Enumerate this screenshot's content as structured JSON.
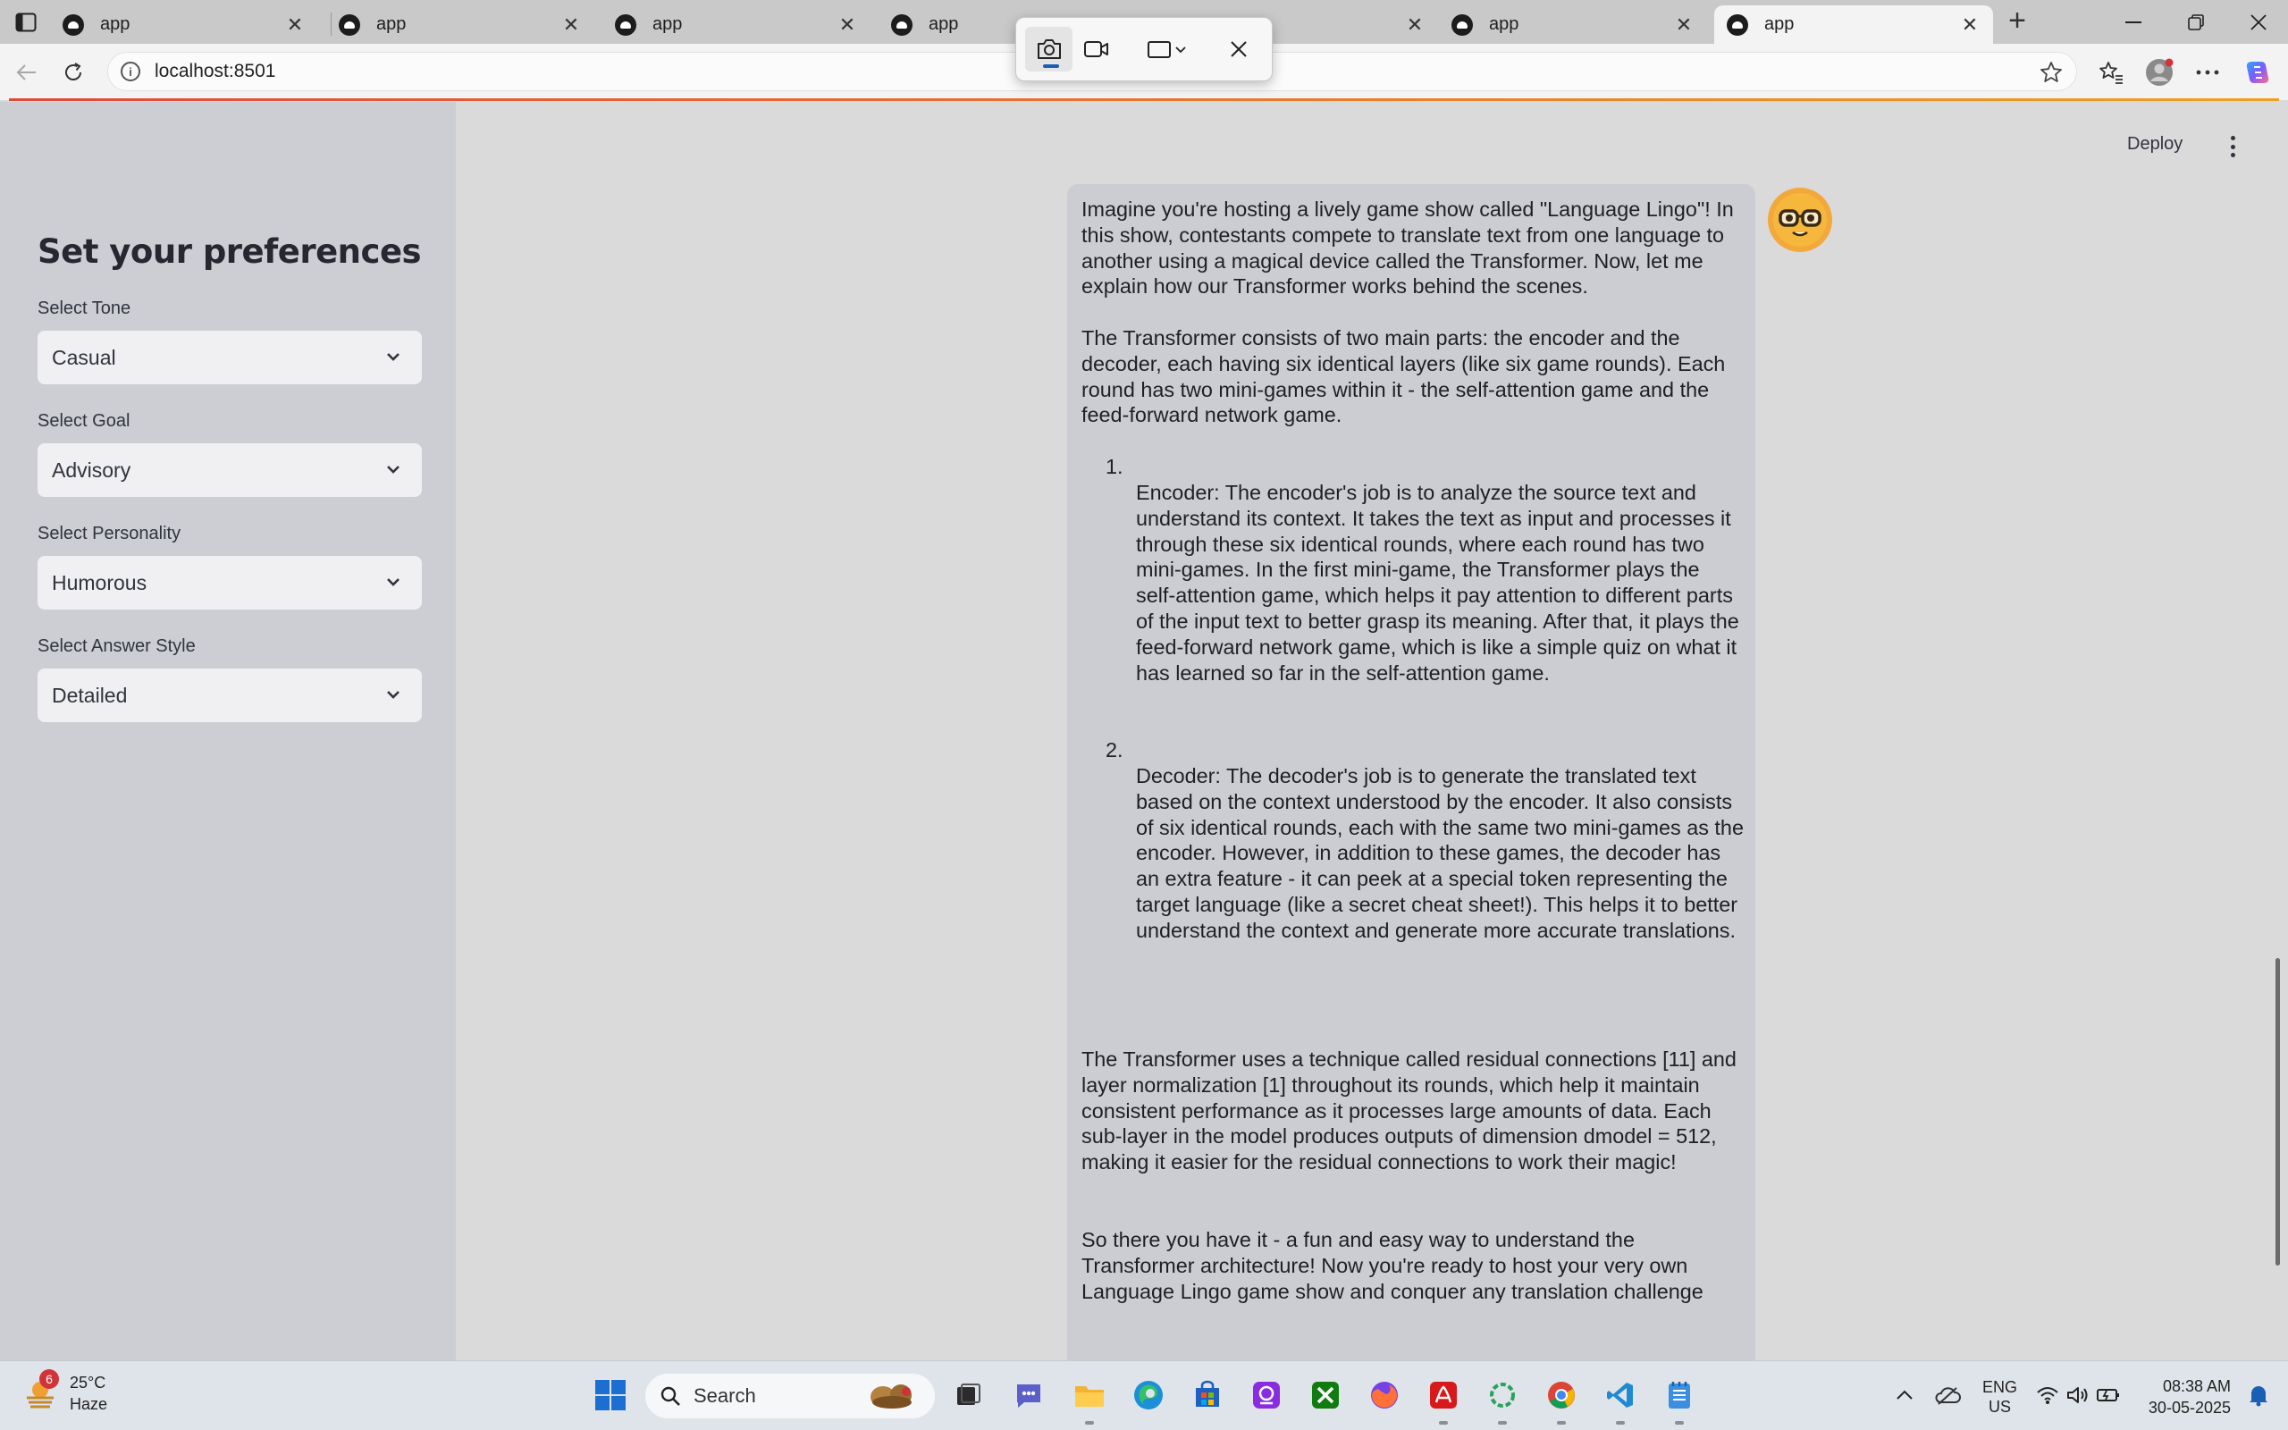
{
  "browser": {
    "tabs": [
      {
        "title": "app",
        "active": false
      },
      {
        "title": "app",
        "active": false
      },
      {
        "title": "app",
        "active": false
      },
      {
        "title": "app",
        "active": false
      },
      {
        "title": "app",
        "active": false
      },
      {
        "title": "app",
        "active": false
      },
      {
        "title": "app",
        "active": true
      }
    ],
    "url": "localhost:8501",
    "icons": {
      "tab_actions": "tab-actions-icon",
      "back": "back-arrow-icon",
      "refresh": "refresh-icon",
      "site_info": "info-icon",
      "favorite": "star-icon",
      "favorites": "favorites-icon",
      "profile": "profile-icon",
      "more": "ellipsis-icon",
      "copilot": "copilot-icon"
    }
  },
  "snip_toolbar": {
    "icons": [
      "camera-icon",
      "video-icon",
      "rectangle-select-icon",
      "close-icon"
    ],
    "selected_mode": "screenshot"
  },
  "sidebar": {
    "title": "Set your preferences",
    "fields": [
      {
        "label": "Select Tone",
        "value": "Casual"
      },
      {
        "label": "Select Goal",
        "value": "Advisory"
      },
      {
        "label": "Select Personality",
        "value": "Humorous"
      },
      {
        "label": "Select Answer Style",
        "value": "Detailed"
      }
    ]
  },
  "header": {
    "deploy_label": "Deploy"
  },
  "chat": {
    "avatar": "nerd-face-emoji",
    "para1": "Imagine you're hosting a lively game show called \"Language Lingo\"! In this show, contestants compete to translate text from one language to another using a magical device called the Transformer. Now, let me explain how our Transformer works behind the scenes.",
    "para2": "The Transformer consists of two main parts: the encoder and the decoder, each having six identical layers (like six game rounds). Each round has two mini-games within it - the self-attention game and the feed-forward network game.",
    "items": [
      {
        "num": "1.",
        "text": "Encoder: The encoder's job is to analyze the source text and understand its context. It takes the text as input and processes it through these six identical rounds, where each round has two mini-games. In the first mini-game, the Transformer plays the self-attention game, which helps it pay attention to different parts of the input text to better grasp its meaning. After that, it plays the feed-forward network game, which is like a simple quiz on what it has learned so far in the self-attention game."
      },
      {
        "num": "2.",
        "text": "Decoder: The decoder's job is to generate the translated text based on the context understood by the encoder. It also consists of six identical rounds, each with the same two mini-games as the encoder. However, in addition to these games, the decoder has an extra feature - it can peek at a special token representing the target language (like a secret cheat sheet!). This helps it to better understand the context and generate more accurate translations."
      }
    ],
    "para3": "The Transformer uses a technique called residual connections [11] and layer normalization [1] throughout its rounds, which help it maintain consistent performance as it processes large amounts of data. Each sub-layer in the model produces outputs of dimension dmodel = 512, making it easier for the residual connections to work their magic!",
    "para4": "So there you have it - a fun and easy way to understand the Transformer architecture! Now you're ready to host your very own Language Lingo game show and conquer any translation challenge"
  },
  "taskbar": {
    "weather": {
      "badge": "6",
      "temp": "25°C",
      "condition": "Haze"
    },
    "search_placeholder": "Search",
    "apps": [
      "windows-start-icon",
      "task-view-icon",
      "chat-icon",
      "file-explorer-icon",
      "edge-icon",
      "store-icon",
      "app-icon",
      "xbox-icon",
      "firefox-icon",
      "acrobat-icon",
      "ring-app-icon",
      "chrome-icon",
      "vscode-icon",
      "notepad-icon"
    ],
    "language": {
      "line1": "ENG",
      "line2": "US"
    },
    "time": "08:38 AM",
    "date": "30-05-2025"
  }
}
